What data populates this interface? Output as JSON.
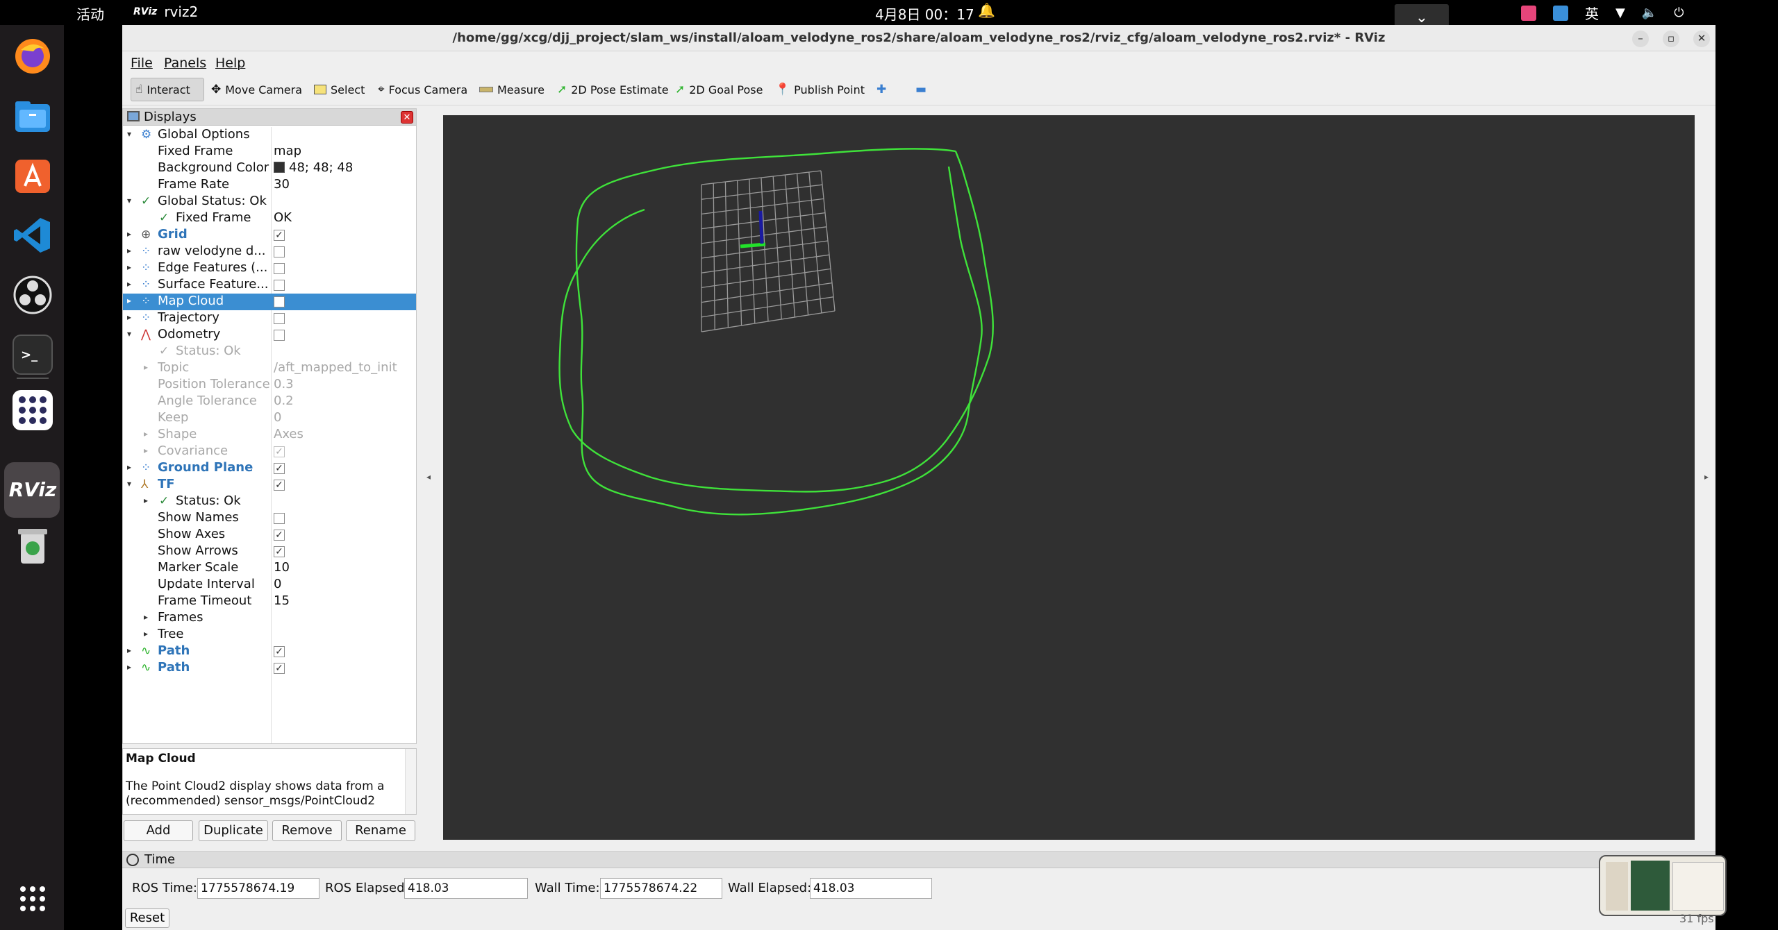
{
  "topbar": {
    "activities": "活动",
    "app_icon_text": "RViz",
    "app_name": "rviz2",
    "clock": "4月8日  00：17",
    "input_method": "英"
  },
  "window": {
    "title": "/home/gg/xcg/djj_project/slam_ws/install/aloam_velodyne_ros2/share/aloam_velodyne_ros2/rviz_cfg/aloam_velodyne_ros2.rviz* - RViz",
    "minimize": "–",
    "maximize": "▫",
    "close": "✕"
  },
  "dock": {
    "rviz_label": "RViz",
    "terminal_prompt": ">_"
  },
  "menu": {
    "file": "File",
    "panels": "Panels",
    "help": "Help"
  },
  "toolbar": {
    "interact": "Interact",
    "move_camera": "Move Camera",
    "select": "Select",
    "focus_camera": "Focus Camera",
    "measure": "Measure",
    "pose_estimate": "2D Pose Estimate",
    "goal_pose": "2D Goal Pose",
    "publish_point": "Publish Point",
    "plus": "✚",
    "minus": "▬"
  },
  "displays": {
    "title": "Displays",
    "close": "✕",
    "rows": [
      {
        "name": "Global Options"
      },
      {
        "name": "Fixed Frame",
        "value": "map"
      },
      {
        "name": "Background Color",
        "value": "48; 48; 48"
      },
      {
        "name": "Frame Rate",
        "value": "30"
      },
      {
        "name": "Global Status: Ok"
      },
      {
        "name": "Fixed Frame",
        "value": "OK"
      },
      {
        "name": "Grid"
      },
      {
        "name": "raw velodyne d..."
      },
      {
        "name": "Edge Features (..."
      },
      {
        "name": "Surface Feature..."
      },
      {
        "name": "Map Cloud"
      },
      {
        "name": "Trajectory"
      },
      {
        "name": "Odometry"
      },
      {
        "name": "Status: Ok"
      },
      {
        "name": "Topic",
        "value": "/aft_mapped_to_init"
      },
      {
        "name": "Position Tolerance",
        "value": "0.3"
      },
      {
        "name": "Angle Tolerance",
        "value": "0.2"
      },
      {
        "name": "Keep",
        "value": "0"
      },
      {
        "name": "Shape",
        "value": "Axes"
      },
      {
        "name": "Covariance"
      },
      {
        "name": "Ground Plane"
      },
      {
        "name": "TF"
      },
      {
        "name": "Status: Ok"
      },
      {
        "name": "Show Names"
      },
      {
        "name": "Show Axes"
      },
      {
        "name": "Show Arrows"
      },
      {
        "name": "Marker Scale",
        "value": "10"
      },
      {
        "name": "Update Interval",
        "value": "0"
      },
      {
        "name": "Frame Timeout",
        "value": "15"
      },
      {
        "name": "Frames"
      },
      {
        "name": "Tree"
      },
      {
        "name": "Path"
      },
      {
        "name": "Path"
      }
    ]
  },
  "description": {
    "heading": "Map Cloud",
    "text": "The Point Cloud2 display shows data from a (recommended) sensor_msgs/PointCloud2"
  },
  "panel_buttons": {
    "add": "Add",
    "duplicate": "Duplicate",
    "remove": "Remove",
    "rename": "Rename"
  },
  "time": {
    "title": "Time",
    "ros_time_label": "ROS Time:",
    "ros_time": "1775578674.19",
    "ros_elapsed_label": "ROS Elapsed:",
    "ros_elapsed": "418.03",
    "wall_time_label": "Wall Time:",
    "wall_time": "1775578674.22",
    "wall_elapsed_label": "Wall Elapsed:",
    "wall_elapsed": "418.03",
    "reset": "Reset"
  },
  "fps": "31 fps",
  "colors": {
    "background": "#303030",
    "path": "#3fe23a",
    "grid": "#a0a0a0",
    "selection": "#3b8ed2"
  }
}
